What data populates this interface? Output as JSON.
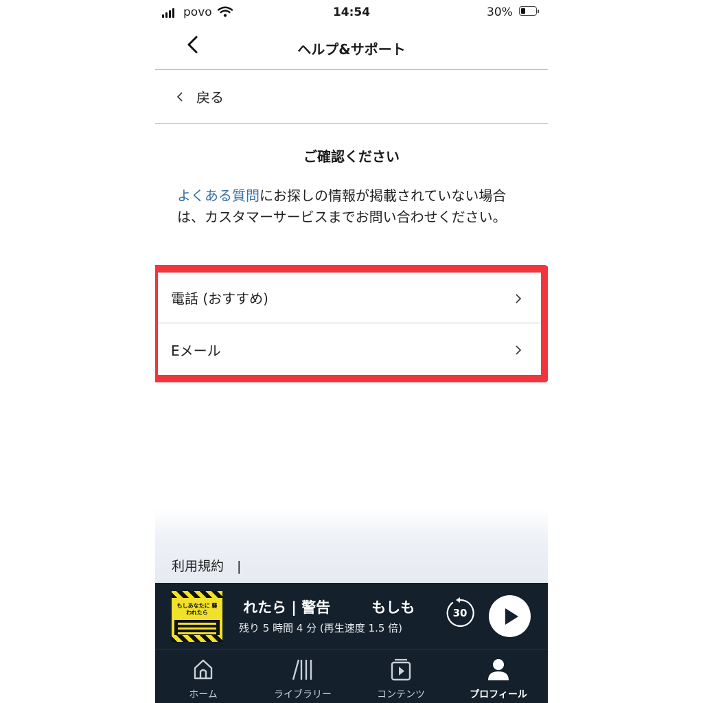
{
  "status_bar": {
    "carrier": "povo",
    "time": "14:54",
    "battery_percent": "30%",
    "battery_level": 0.3
  },
  "header": {
    "title": "ヘルプ&サポート",
    "back_icon": "chevron-left-icon"
  },
  "back_row": {
    "label": "戻る"
  },
  "content": {
    "heading": "ご確認ください",
    "link_text": "よくある質問",
    "paragraph_rest": "にお探しの情報が掲載されていない場合は、カスタマーサービスまでお問い合わせください。"
  },
  "options": [
    {
      "label": "電話 (おすすめ)",
      "icon": "chevron-right-icon"
    },
    {
      "label": "Eメール",
      "icon": "chevron-right-icon"
    }
  ],
  "highlight_color": "#f2353d",
  "footer": {
    "terms": "利用規約　|"
  },
  "player": {
    "title_part1": "れたら | 警告",
    "title_part2": "もしも",
    "subtitle": "残り 5 時間 4 分 (再生速度 1.5 倍)",
    "skip_seconds": "30",
    "cover_text": "もしあなたに 襲われたら"
  },
  "tabs": [
    {
      "label": "ホーム",
      "icon": "home-icon",
      "active": false
    },
    {
      "label": "ライブラリー",
      "icon": "library-icon",
      "active": false
    },
    {
      "label": "コンテンツ",
      "icon": "content-icon",
      "active": false
    },
    {
      "label": "プロフィール",
      "icon": "profile-icon",
      "active": true
    }
  ]
}
